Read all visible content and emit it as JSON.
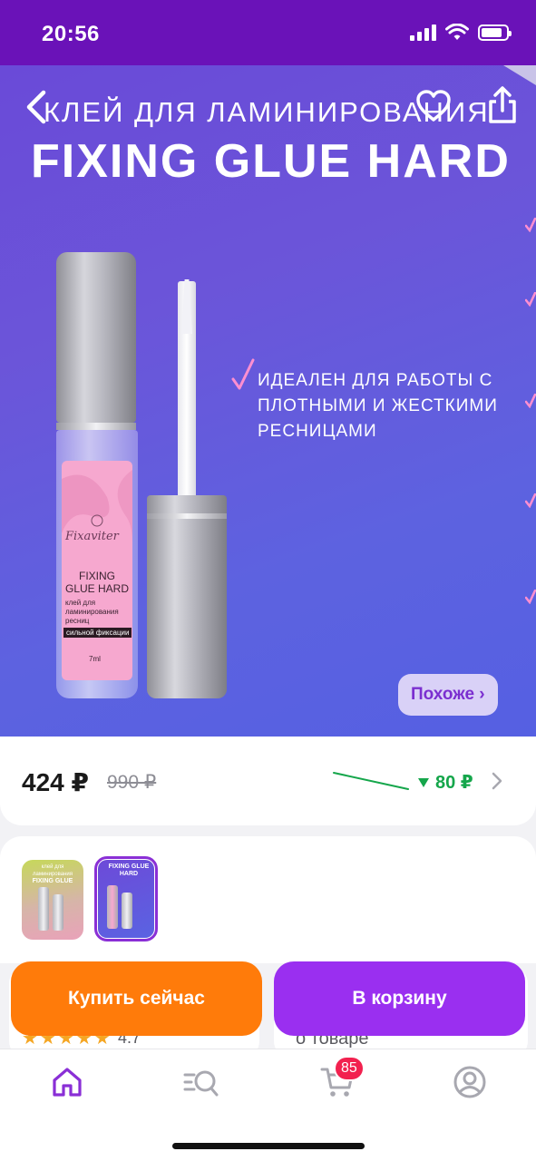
{
  "status_bar": {
    "time": "20:56",
    "battery_level": 0.85
  },
  "hero": {
    "subtitle": "клей для ламинирования",
    "title": "FIXING GLUE HARD",
    "feature_text": "идеален для работы с плотными и жесткими ресницами",
    "similar_label": "Похоже ›",
    "package": {
      "brand": "Fixaviter",
      "name": "FIXING GLUE HARD",
      "description": "клей для ламинирования ресниц",
      "tag": "сильной фиксации",
      "volume": "7ml"
    },
    "accent_color": "#ff8fd0"
  },
  "price": {
    "current": "424 ₽",
    "old": "990 ₽",
    "drop": "80 ₽",
    "drop_color": "#15a64b"
  },
  "thumbnails": [
    {
      "top_text": "клей для ламинирования",
      "title": "FIXING GLUE",
      "selected": false
    },
    {
      "top_text": "",
      "title": "FIXING GLUE HARD",
      "selected": true
    }
  ],
  "rating": {
    "stars": 5,
    "value": "4.7"
  },
  "about_label": "о товаре",
  "actions": {
    "buy_now": "Купить сейчас",
    "add_to_cart": "В корзину",
    "buy_color": "#ff7b0a",
    "cart_color": "#9a2ff0"
  },
  "tabbar": {
    "items": [
      "home-icon",
      "catalog-search-icon",
      "cart-icon",
      "profile-icon"
    ],
    "cart_badge": "85",
    "active_color": "#8a2fd6"
  }
}
